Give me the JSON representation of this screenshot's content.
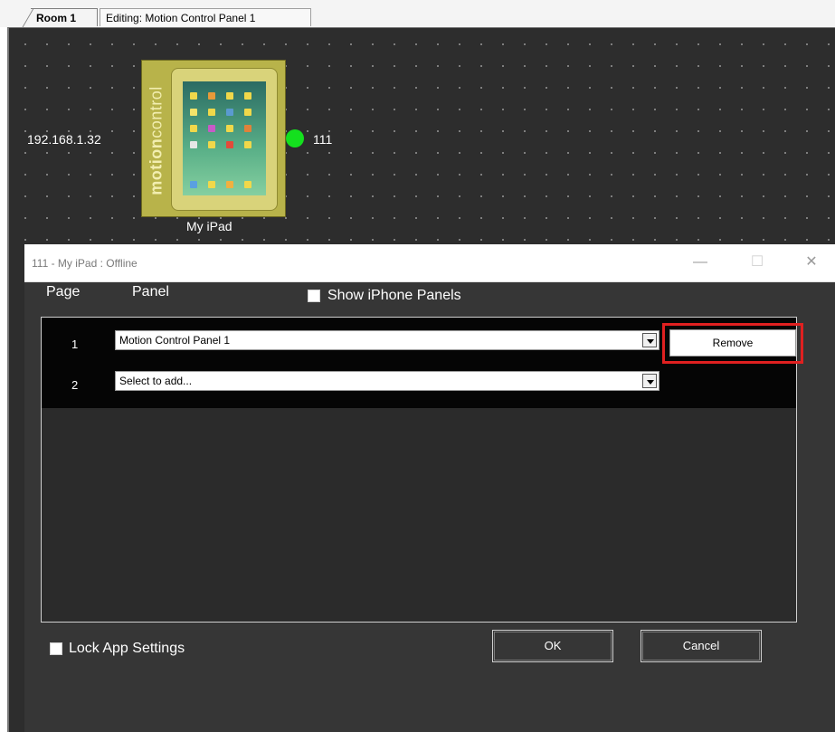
{
  "tabs": [
    {
      "label": "Room 1",
      "active": true
    },
    {
      "label": "Editing: Motion Control Panel 1",
      "active": false
    }
  ],
  "canvas": {
    "ip_address": "192.168.1.32",
    "device_id": "111",
    "device_name": "My iPad",
    "brand_light": "motion",
    "brand_regular": "control",
    "status_color": "#14e01e"
  },
  "dialog": {
    "title": "111 - My iPad : Offline",
    "minimize_glyph": "—",
    "maximize_glyph": "☐",
    "close_glyph": "✕",
    "col_page": "Page",
    "col_panel": "Panel",
    "show_iphone_label": "Show iPhone Panels",
    "show_iphone_checked": false,
    "rows": [
      {
        "page": "1",
        "panel": "Motion Control Panel 1"
      },
      {
        "page": "2",
        "panel": "Select to add..."
      }
    ],
    "remove_label": "Remove",
    "lock_label": "Lock App Settings",
    "lock_checked": false,
    "ok_label": "OK",
    "cancel_label": "Cancel",
    "highlight_color": "#e02020"
  }
}
